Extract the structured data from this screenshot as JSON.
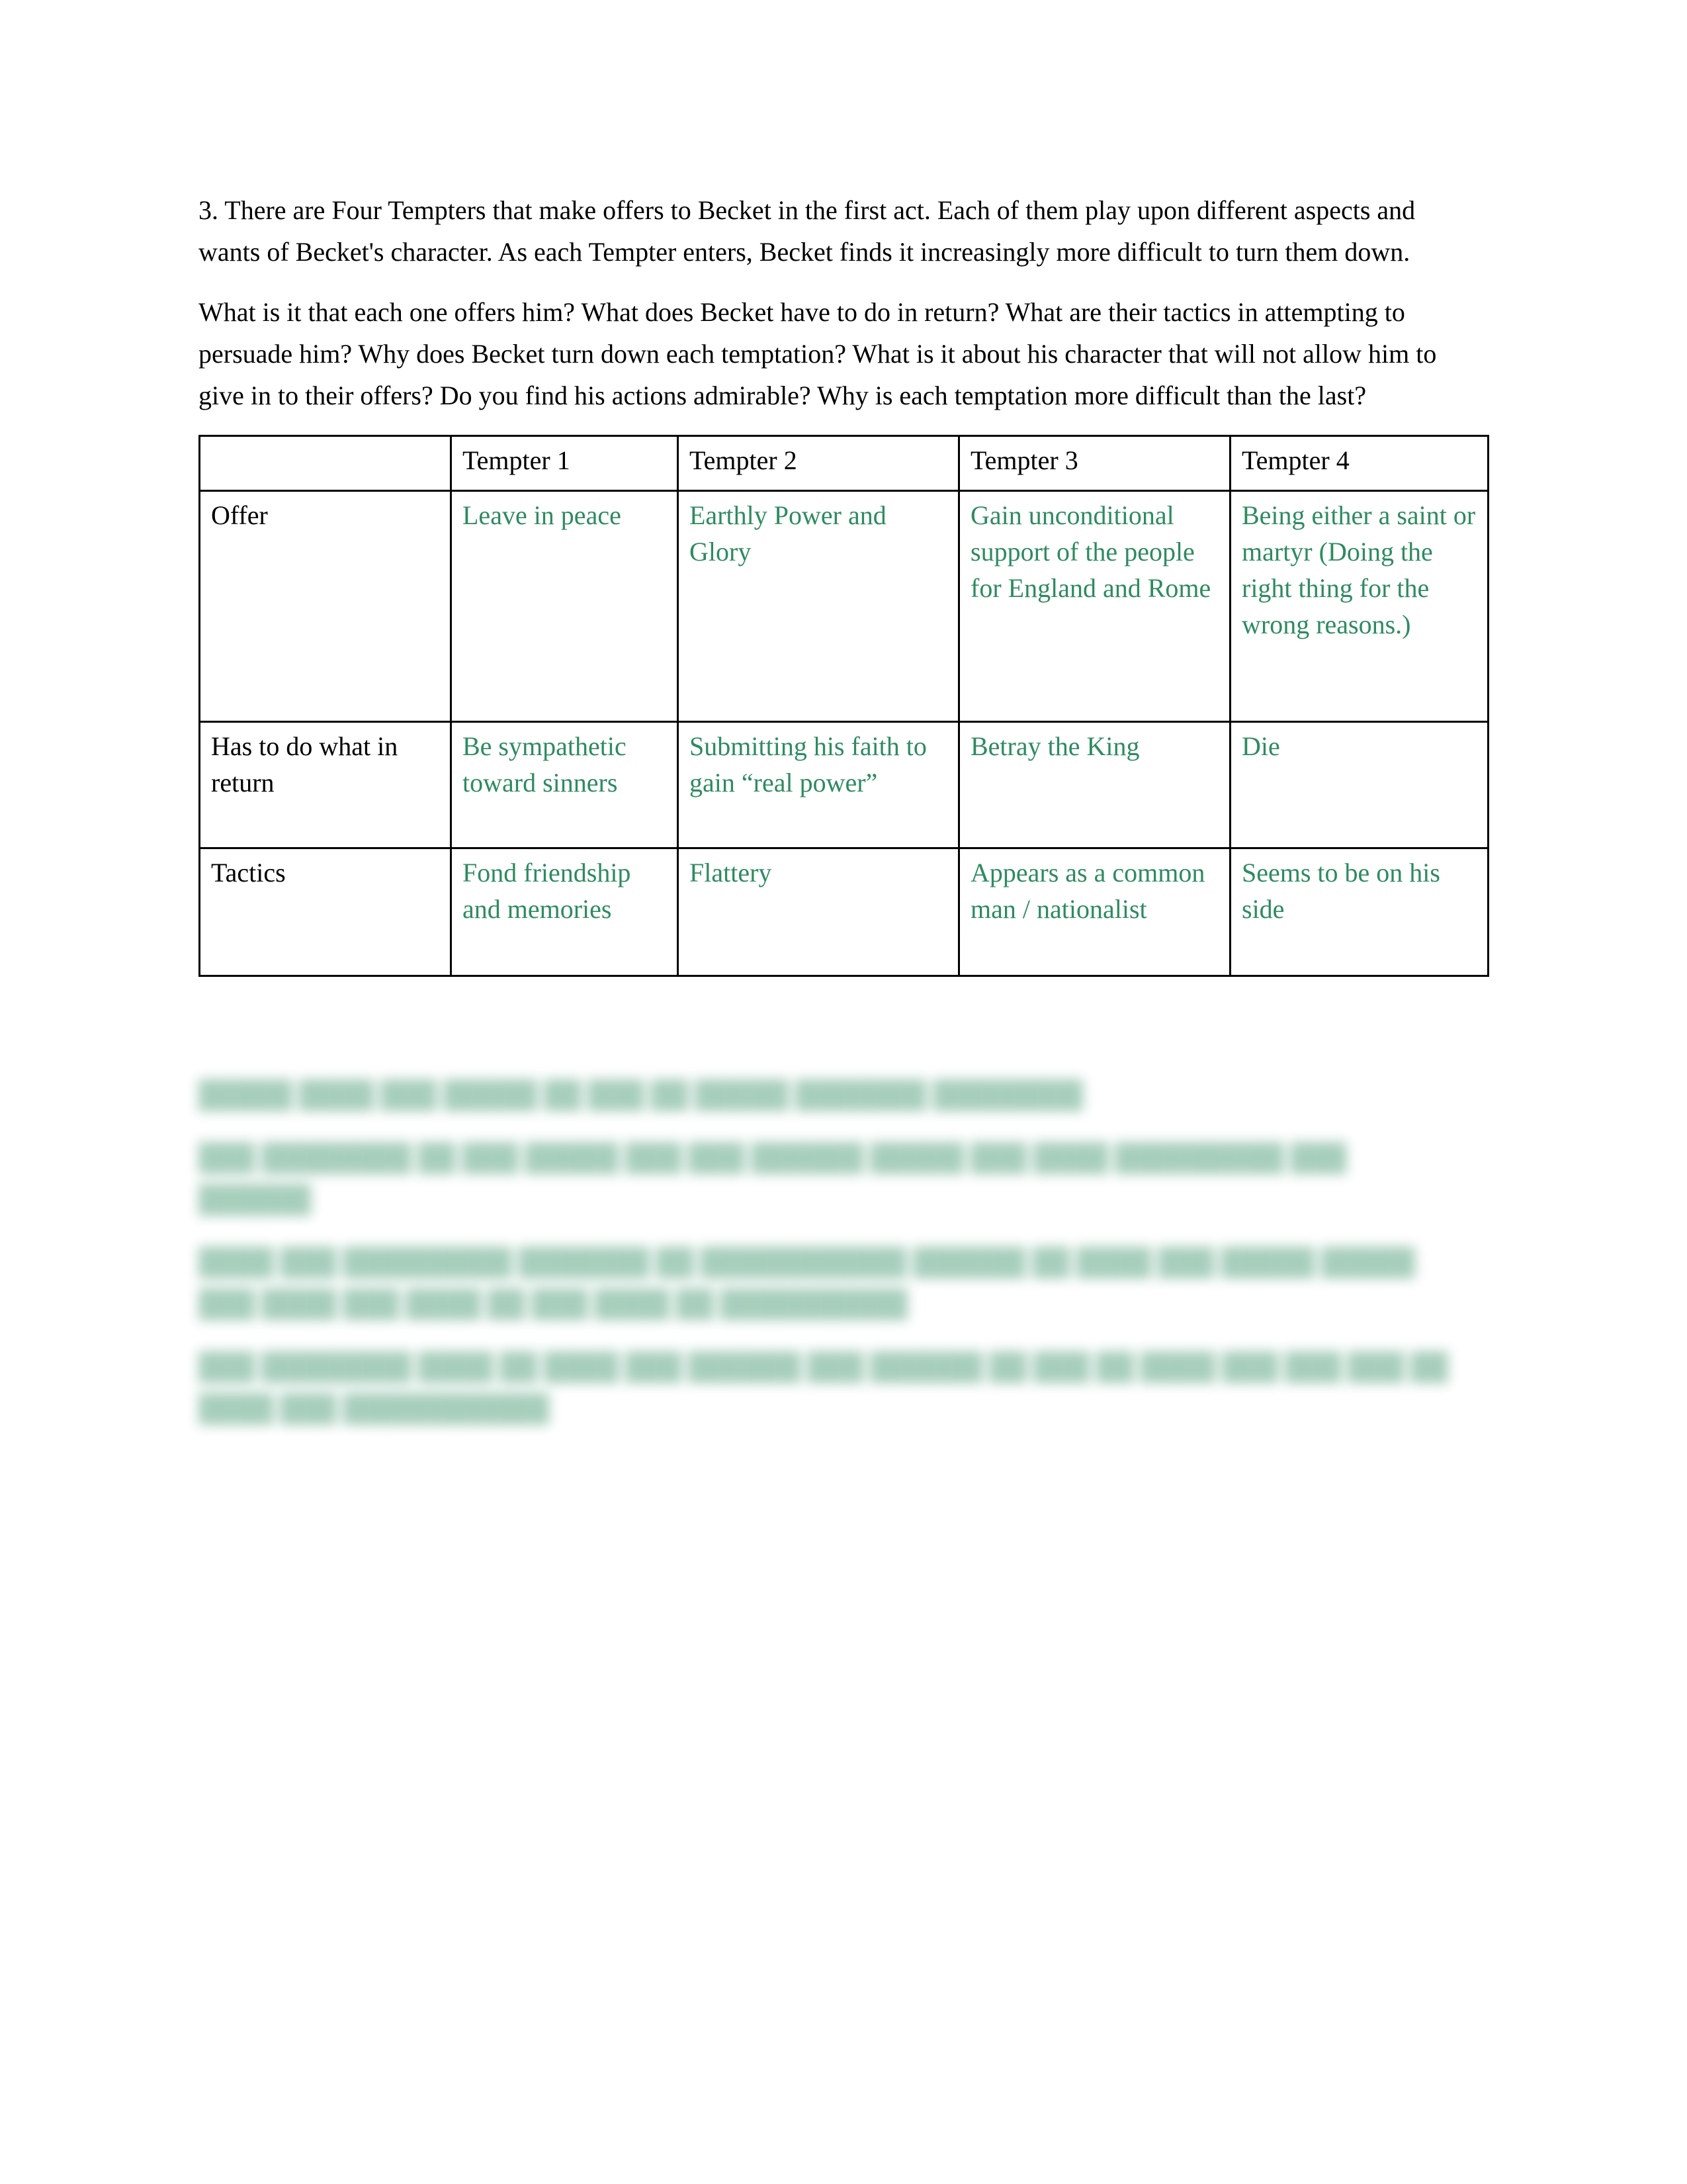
{
  "document": {
    "paragraphs": [
      "3. There are Four Tempters that make offers to Becket in the first act. Each of them play upon different aspects and wants of Becket's character. As each Tempter enters, Becket finds it increasingly more difficult to turn them down.",
      "What is it that each one offers him? What does Becket have to do in return? What are their tactics in attempting to persuade him? Why does Becket turn down each temptation? What is it about his character that will not allow him to give in to their offers? Do you find his actions admirable? Why is each temptation more difficult than the last?"
    ],
    "accent_color": "#2e8b60",
    "text_color": "#000000"
  },
  "table": {
    "headers": [
      "",
      "Tempter 1",
      "Tempter 2",
      "Tempter 3",
      "Tempter 4"
    ],
    "rows": [
      {
        "label": "Offer",
        "cells": [
          "Leave in peace",
          "Earthly Power and Glory",
          "Gain unconditional support of the people for England and Rome",
          "Being either a saint or martyr (Doing the right thing for the wrong reasons.)"
        ]
      },
      {
        "label": "Has to do what in return",
        "cells": [
          "Be sympathetic toward sinners",
          "Submitting his faith to gain “real power”",
          "Betray the King",
          "Die"
        ]
      },
      {
        "label": "Tactics",
        "cells": [
          "Fond friendship and memories",
          "Flattery",
          "Appears as a common man / nationalist",
          "Seems to be on his side"
        ]
      }
    ]
  },
  "redacted_block": {
    "note": "blurred illegible green text",
    "lines": [
      "█████ ████ ███ █████ ██ ███ ██ █████ ███████ ████████",
      "███ ████████ ██ ███ █████ ███ ███ ██████ █████ ███ ████ █████████ ███ ██████",
      "████ ███ █████████ ███████ ██ ███████████ ██████ ██ ████ ███ █████ █████ ███ ████ ███ ████ ██ ███ ████ ██ ██████████",
      "███ ████████ ████ ██ ████ ███ ██████ ███ ██████ ██ ███ ██ ████ ███ ███ ███ ██ ████ ███ ███████████"
    ]
  }
}
